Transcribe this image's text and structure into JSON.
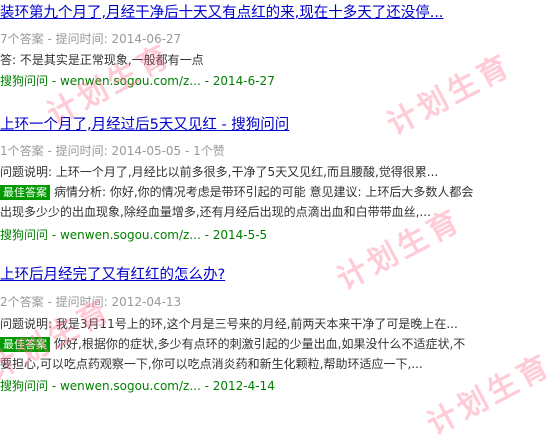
{
  "results": [
    {
      "title": "装环第九个月了,月经干净后十天又有点红的来,现在十多天了还没停...",
      "meta": "7个答案 - 提问时间: 2014-06-27",
      "answer": "答:  不是其实是正常现象,一般都有一点",
      "source": "搜狗问问 - wenwen.sogou.com/z... - 2014-6-27"
    },
    {
      "title": "上环一个月了,月经过后5天又见红 - 搜狗问问",
      "meta": "1个答案 - 提问时间: 2014-05-05 - 1个赞",
      "question": "问题说明: 上环一个月了,月经比以前多很多,干净了5天又见红,而且腰酸,觉得很累...",
      "badge": "最佳答案",
      "answer_line1": "病情分析: 你好,你的情况考虑是带环引起的可能 意见建议: 上环后大多数人都会",
      "answer_line2": "出现多少少的出血现象,除经血量增多,还有月经后出现的点滴出血和白带带血丝,...",
      "source": "搜狗问问 - wenwen.sogou.com/z... - 2014-5-5"
    },
    {
      "title": "上环后月经完了又有红红的怎么办?",
      "meta": "2个答案 - 提问时间: 2012-04-13",
      "question": "问题说明: 我是3月11号上的环,这个月是三号来的月经,前两天本来干净了可是晚上在...",
      "badge": "最佳答案",
      "answer_line1": "你好,根据你的症状,多少有点环的刺激引起的少量出血,如果没什么不适症状,不",
      "answer_line2": "要担心,可以吃点药观察一下,你可以吃点消炎药和新生化颗粒,帮助环适应一下,...",
      "source": "搜狗问问 - wenwen.sogou.com/z... - 2012-4-14"
    }
  ],
  "watermark_text": "计划生育",
  "colors": {
    "title_link": "#0000cc",
    "highlight": "#cc0000",
    "meta_gray": "#999999",
    "source_green": "#008000",
    "badge_green": "#009a00",
    "watermark_pink": "#ff698c"
  }
}
